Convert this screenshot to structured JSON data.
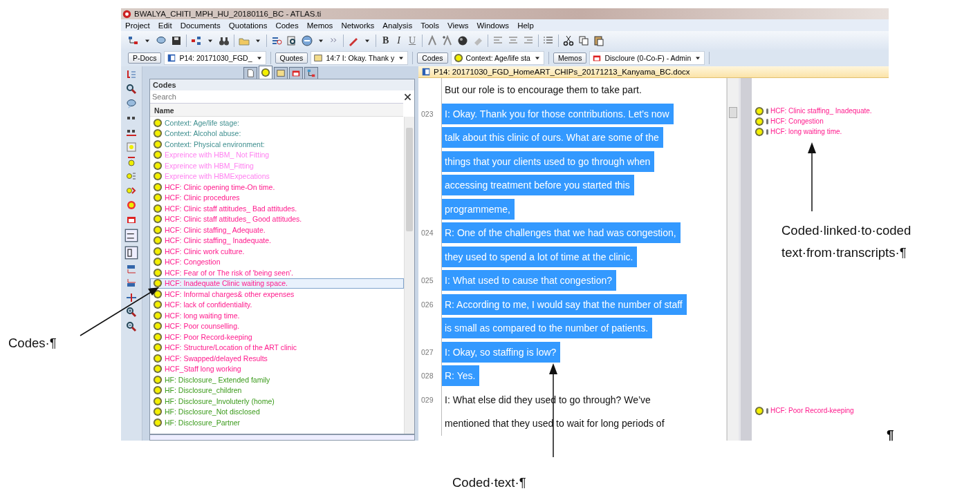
{
  "window": {
    "title": "BWALYA_CHITI_MPH_HU_20180116_BC - ATLAS.ti"
  },
  "menu": [
    "Project",
    "Edit",
    "Documents",
    "Quotations",
    "Codes",
    "Memos",
    "Networks",
    "Analysis",
    "Tools",
    "Views",
    "Windows",
    "Help"
  ],
  "toolbar": {
    "format_buttons": [
      "B",
      "I",
      "U"
    ]
  },
  "selectors": [
    {
      "button": "P-Docs",
      "value": "P14: 20171030_FGD_",
      "kind": "document"
    },
    {
      "button": "Quotes",
      "value": "14:7 I: Okay. Thank y",
      "kind": "quote"
    },
    {
      "button": "Codes",
      "value": "Context: Age/life sta",
      "kind": "code"
    },
    {
      "button": "Memos",
      "value": "Discloure (0-Co-F) - Admin",
      "kind": "memo"
    }
  ],
  "navigator_tabs": [
    {
      "kind": "document",
      "selected": false
    },
    {
      "kind": "code",
      "selected": true
    },
    {
      "kind": "quote",
      "selected": false
    },
    {
      "kind": "memo",
      "selected": false
    },
    {
      "kind": "network",
      "selected": false
    }
  ],
  "codes_panel": {
    "title": "Codes",
    "search": {
      "placeholder": "Search"
    },
    "column": "Name",
    "items": [
      {
        "name": "Context: Age/life stage:",
        "color": "#3f8f8f",
        "selected": false
      },
      {
        "name": "Context: Alcohol abuse:",
        "color": "#3f8f8f",
        "selected": false
      },
      {
        "name": "Context: Physical environment:",
        "color": "#3f8f8f",
        "selected": false
      },
      {
        "name": "Expreince with HBM_ Not Fitting",
        "color": "#ff80f0",
        "selected": false
      },
      {
        "name": "Expreince with HBM_Fitting",
        "color": "#ff80f0",
        "selected": false
      },
      {
        "name": "Expreince with HBMExpecations",
        "color": "#ff80f0",
        "selected": false
      },
      {
        "name": "HCF: Clinic opening time-On time.",
        "color": "#ff1a8c",
        "selected": false
      },
      {
        "name": "HCF: Clinic procedures",
        "color": "#ff1a8c",
        "selected": false
      },
      {
        "name": "HCF: Clinic staff attitudes_ Bad attitudes.",
        "color": "#ff1a8c",
        "selected": false
      },
      {
        "name": "HCF: Clinic staff attitudes_ Good attitudes.",
        "color": "#ff1a8c",
        "selected": false
      },
      {
        "name": "HCF: Clinic staffing_ Adequate.",
        "color": "#ff1a8c",
        "selected": false
      },
      {
        "name": "HCF: Clinic staffing_ Inadequate.",
        "color": "#ff1a8c",
        "selected": false
      },
      {
        "name": "HCF: Clinic work culture.",
        "color": "#ff1a8c",
        "selected": false
      },
      {
        "name": "HCF: Congestion",
        "color": "#ff1a8c",
        "selected": false
      },
      {
        "name": "HCF: Fear of or The risk of 'being seen'.",
        "color": "#ff1a8c",
        "selected": false
      },
      {
        "name": "HCF: Inadequate Clinic waiting space.",
        "color": "#ff1a8c",
        "selected": true
      },
      {
        "name": "HCF: Informal charges& other expenses",
        "color": "#ff1a8c",
        "selected": false
      },
      {
        "name": "HCF: lack of confidentiality.",
        "color": "#ff1a8c",
        "selected": false
      },
      {
        "name": "HCF: long waiting time.",
        "color": "#ff1a8c",
        "selected": false
      },
      {
        "name": "HCF: Poor counselling.",
        "color": "#ff1a8c",
        "selected": false
      },
      {
        "name": "HCF: Poor Record-keeping",
        "color": "#ff1a8c",
        "selected": false
      },
      {
        "name": "HCF: Structure/Location of the ART clinic",
        "color": "#ff1a8c",
        "selected": false
      },
      {
        "name": "HCF: Swapped/delayed Results",
        "color": "#ff1a8c",
        "selected": false
      },
      {
        "name": "HCF_Staff long working",
        "color": "#ff1a8c",
        "selected": false
      },
      {
        "name": "HF:  Disclosure_ Extended family",
        "color": "#3a9a1a",
        "selected": false
      },
      {
        "name": "HF:  Disclosure_children",
        "color": "#3a9a1a",
        "selected": false
      },
      {
        "name": "HF:  Disclosure_Involuterly (home)",
        "color": "#3a9a1a",
        "selected": false
      },
      {
        "name": "HF:  Disclosure_Not disclosed",
        "color": "#3a9a1a",
        "selected": false
      },
      {
        "name": "HF:  Disclosure_Partner",
        "color": "#3a9a1a",
        "selected": false
      }
    ]
  },
  "document": {
    "title": "P14:  20171030_FGD_HomeART_CHIPs_20171213_Kanyama_BC.docx",
    "lines": [
      {
        "text": "But our role is to encourage them to take part.",
        "coded": false
      },
      {
        "number": "023",
        "text": "I: Okay. Thank you for those contributions.  Let’s now",
        "coded": true
      },
      {
        "text": "talk about this clinic of ours. What are some of the",
        "coded": true
      },
      {
        "text": "things that your clients used to go through when",
        "coded": true
      },
      {
        "text": "accessing treatment before you started this",
        "coded": true
      },
      {
        "text": "programmeme,",
        "coded": true
      },
      {
        "number": "024",
        "text": "R: One of the challenges that we had was congestion,",
        "coded": true
      },
      {
        "text": "they used to spend a lot of time at the clinic.",
        "coded": true
      },
      {
        "number": "025",
        "text": "I: What used to cause that congestion?",
        "coded": true
      },
      {
        "number": "026",
        "text": "R: According to me, I would say that the number of staff",
        "coded": true
      },
      {
        "text": "is small as compared to the number of patients.",
        "coded": true
      },
      {
        "number": "027",
        "text": "I: Okay, so staffing is low?",
        "coded": true
      },
      {
        "number": "028",
        "text": "R: Yes.",
        "coded": true
      },
      {
        "number": "029",
        "text": "I:  What else did they used to go through?  We’ve",
        "coded": false
      },
      {
        "text": "mentioned that they used to wait for long periods of",
        "coded": false
      }
    ],
    "margin_groups": [
      [
        "HCF: Clinic staffing_ Inadequate.",
        "HCF: Congestion",
        "HCF: long waiting time."
      ],
      [
        "HCF: Poor Record-keeping"
      ]
    ]
  },
  "annotations": {
    "codes_label": "Codes·¶",
    "margin_label": [
      "Coded·linked·to·coded",
      "text·from·transcripts·¶"
    ],
    "text_label": "Coded·text·¶",
    "pilcrow": "¶"
  }
}
